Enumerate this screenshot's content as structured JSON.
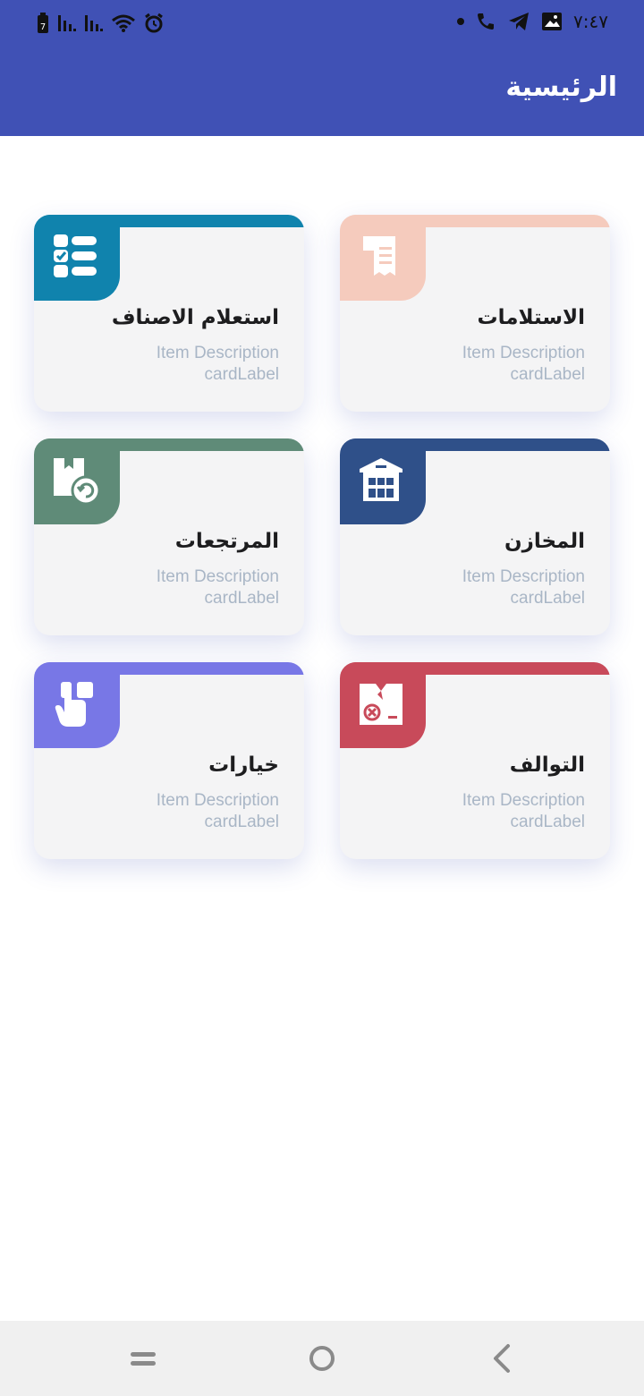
{
  "status": {
    "time": "٧:٤٧",
    "battery_level": "7",
    "icons": [
      "battery-icon",
      "signal-icon",
      "signal-icon",
      "wifi-icon",
      "alarm-icon",
      "dot-icon",
      "call-icon",
      "telegram-icon",
      "image-icon"
    ]
  },
  "appbar": {
    "title": "الرئيسية"
  },
  "cards": [
    {
      "title": "الاستلامات",
      "desc": "Item Description",
      "label": "cardLabel",
      "color": "#f5cbbd",
      "icon": "receipt-icon"
    },
    {
      "title": "استعلام الاصناف",
      "desc": "Item Description",
      "label": "cardLabel",
      "color": "#1083ad",
      "icon": "checklist-icon"
    },
    {
      "title": "المخازن",
      "desc": "Item Description",
      "label": "cardLabel",
      "color": "#2f5089",
      "icon": "warehouse-icon"
    },
    {
      "title": "المرتجعات",
      "desc": "Item Description",
      "label": "cardLabel",
      "color": "#5f8b78",
      "icon": "return-box-icon"
    },
    {
      "title": "التوالف",
      "desc": "Item Description",
      "label": "cardLabel",
      "color": "#c84a5a",
      "icon": "damaged-box-icon"
    },
    {
      "title": "خيارات",
      "desc": "Item Description",
      "label": "cardLabel",
      "color": "#7877e6",
      "icon": "touch-icon"
    }
  ],
  "navbar": {
    "icons": [
      "menu-icon",
      "home-icon",
      "back-icon"
    ]
  }
}
